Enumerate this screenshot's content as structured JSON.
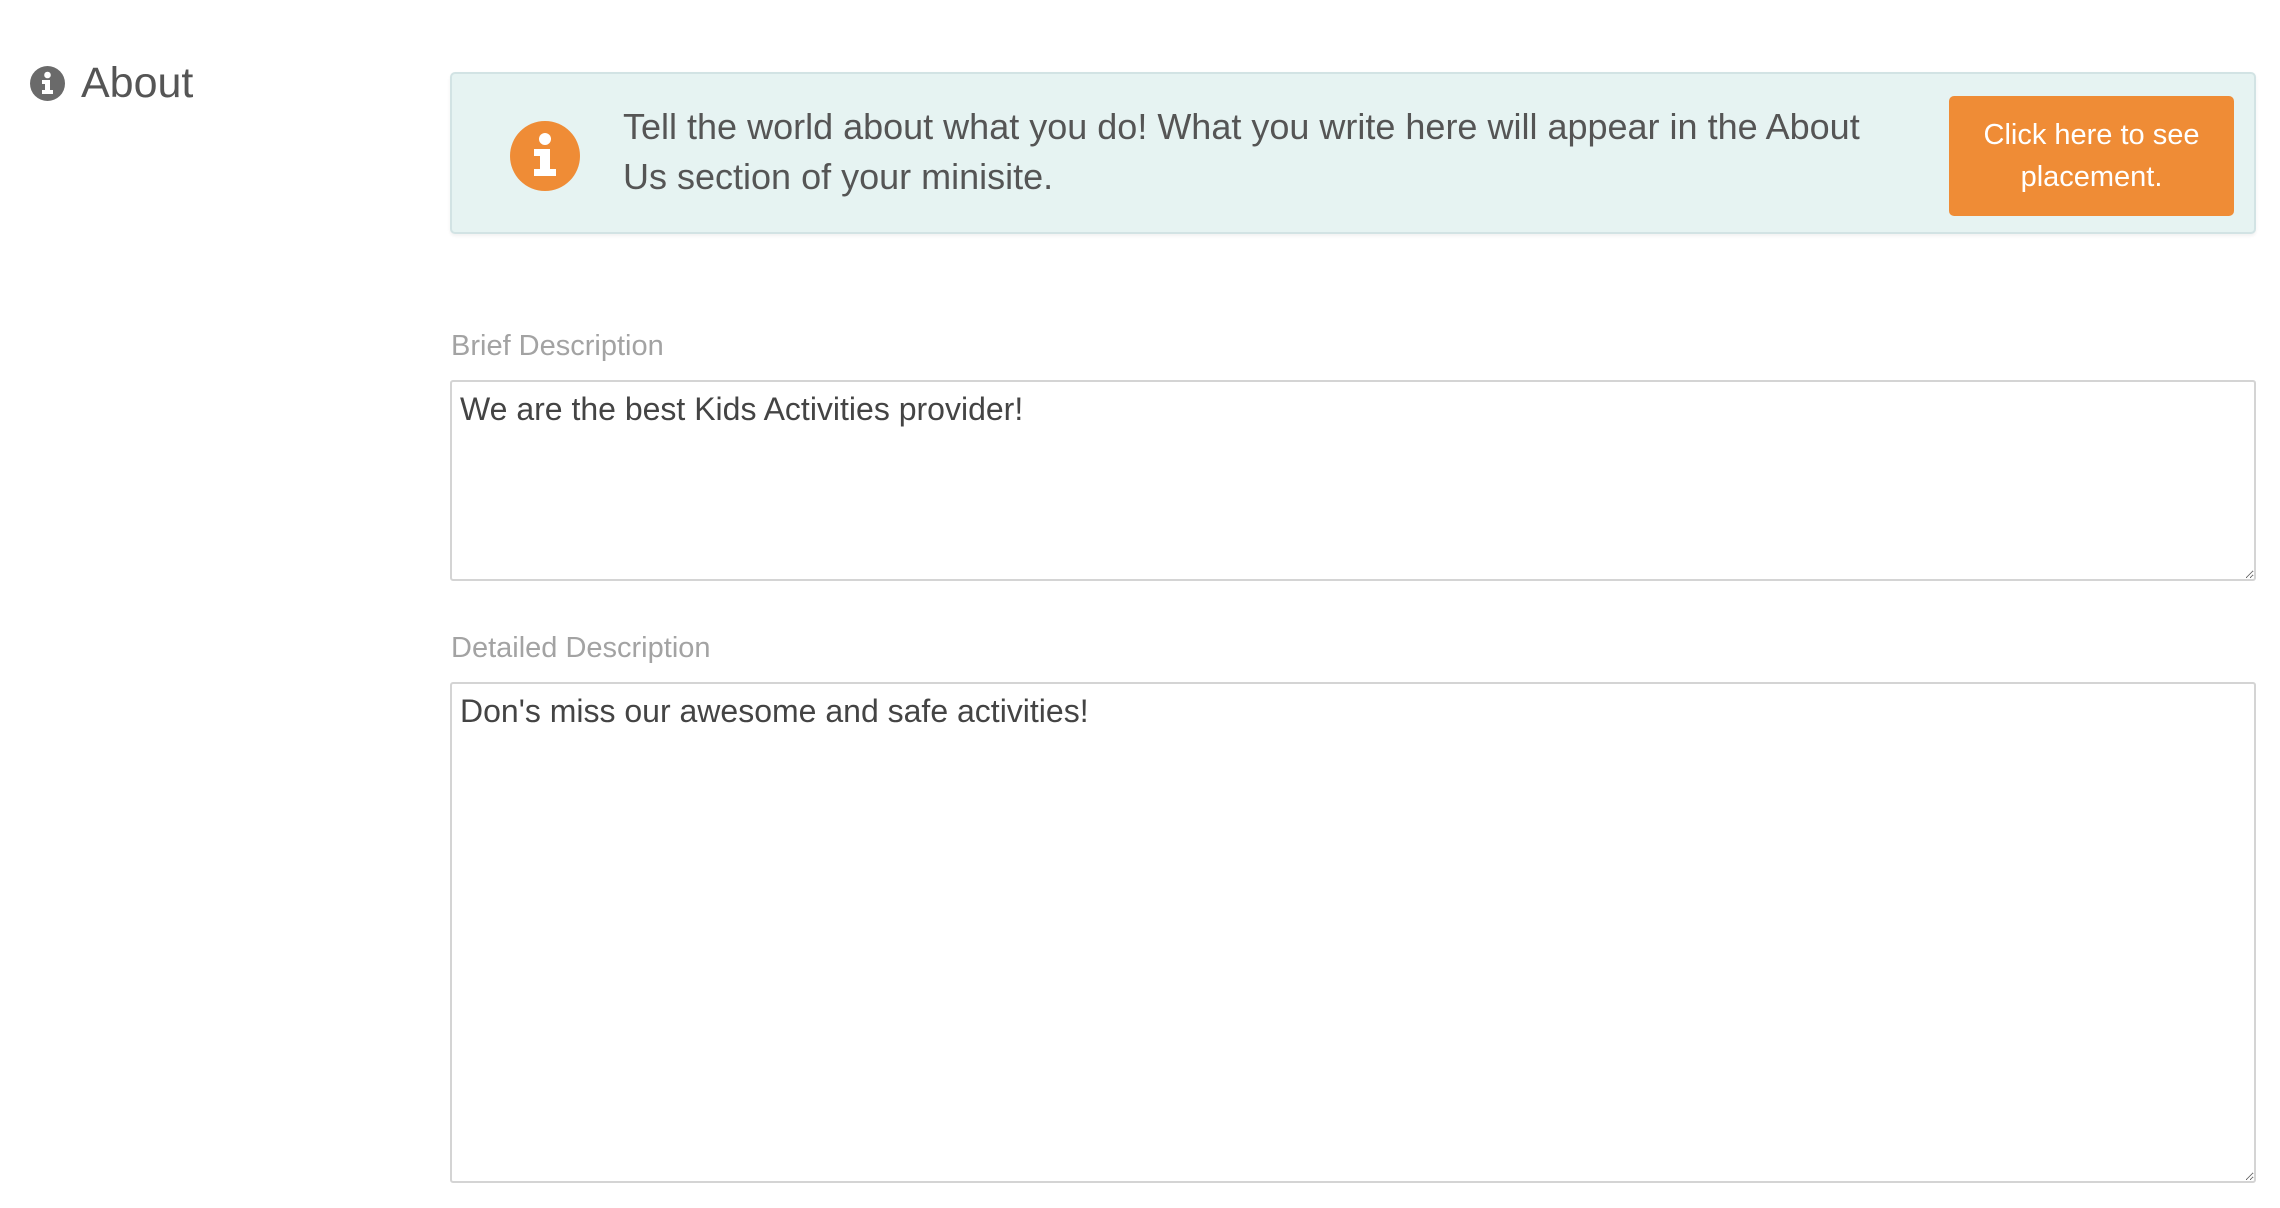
{
  "section": {
    "title": "About",
    "icon": "info-circle-icon"
  },
  "info_box": {
    "icon": "info-icon",
    "message": "Tell the world about what you do! What you write here will appear in the About Us section of your minisite.",
    "button_label": "Click here to see placement."
  },
  "brief_description": {
    "label": "Brief Description",
    "value": "We are the best Kids Activities provider!"
  },
  "detailed_description": {
    "label": "Detailed Description",
    "value": "Don's miss our awesome and safe activities!"
  },
  "colors": {
    "accent": "#ef8c36",
    "info_background": "#e6f3f2",
    "heading_icon": "#666666"
  }
}
